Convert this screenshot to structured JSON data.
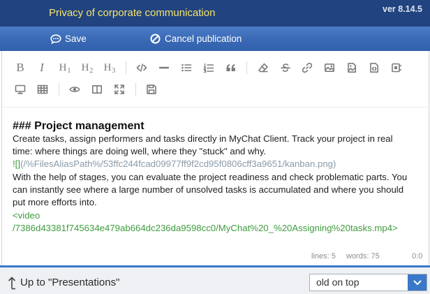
{
  "window": {
    "title": "Privacy of corporate communication",
    "version": "ver 8.14.5"
  },
  "actions": {
    "save": {
      "label": "Save",
      "icon": "chat-bubble-icon"
    },
    "cancel": {
      "label": "Cancel publication",
      "icon": "cancel-circle-icon"
    }
  },
  "toolbar": {
    "bold": "B",
    "italic": "I",
    "h1": {
      "glyph": "H",
      "sub": "1"
    },
    "h2": {
      "glyph": "H",
      "sub": "2"
    },
    "h3": {
      "glyph": "H",
      "sub": "3"
    },
    "row1_icons": [
      "bold-icon",
      "italic-icon",
      "heading-1-icon",
      "heading-2-icon",
      "heading-3-icon",
      "code-icon",
      "horizontal-rule-icon",
      "bullet-list-icon",
      "numbered-list-icon",
      "quote-icon",
      "eraser-icon",
      "strikethrough-icon",
      "link-icon",
      "image-icon",
      "upload-image-icon",
      "file-icon",
      "video-icon"
    ],
    "row2_icons": [
      "monitor-icon",
      "table-icon",
      "eye-icon",
      "side-by-side-icon",
      "fullscreen-icon",
      "save-icon"
    ]
  },
  "editor": {
    "heading": "### Project management",
    "paragraph_1": [
      "Create tasks, assign performers and tasks directly in MyChat Client. Track your project in real",
      "time: where things are doing well, where they \"stuck\" and why."
    ],
    "image": {
      "alt_marker": "![]",
      "url": "(/%FilesAliasPath%/53ffc244fcad09977ff9f2cd95f0806cff3a9651/kanban.png)"
    },
    "paragraph_2": [
      "With the help of stages, you can evaluate the project readiness and check problematic parts. You",
      "can instantly see where a large number of unsolved tasks is accumulated and where you should",
      "put more efforts into."
    ],
    "video": [
      "<video",
      "/7386d43381f745634e479ab664dc236da9598cc0/MyChat%20_%20Assigning%20tasks.mp4>"
    ]
  },
  "status": {
    "lines": "lines: 5",
    "words": "words: 75",
    "cursor": "0:0"
  },
  "footer": {
    "up_label": "Up to \"Presentations\"",
    "up_icon": "up-arrow-icon",
    "sort_selected": "old on top",
    "sort_icon": "chevron-down-icon"
  },
  "colors": {
    "title_bar": "#21437f",
    "action_bar": "#3a69b4",
    "title_text": "#f4e46c",
    "accent": "#3a78c9",
    "markdown_tag": "#3e9c3e",
    "markdown_url": "#8a9ba8"
  }
}
